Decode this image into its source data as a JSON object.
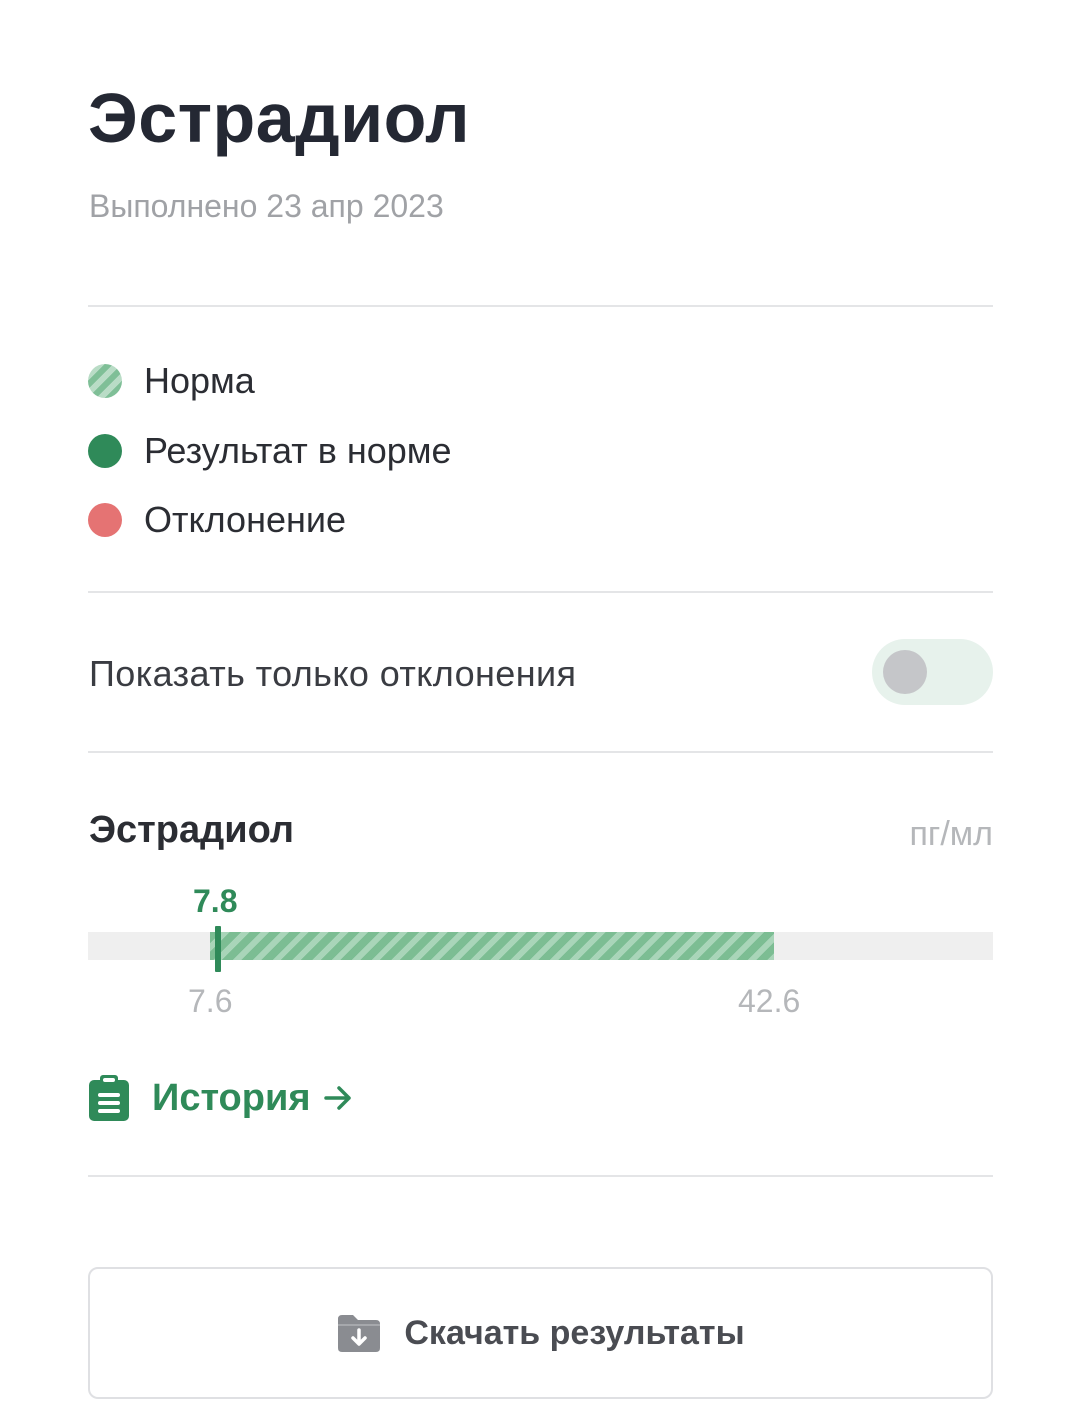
{
  "header": {
    "title": "Эстрадиол",
    "subtitle": "Выполнено 23 апр 2023"
  },
  "legend": {
    "items": [
      {
        "label": "Норма",
        "icon": "striped-green-dot-icon",
        "color": "#7fbf97"
      },
      {
        "label": "Результат в норме",
        "icon": "green-dot-icon",
        "color": "#2f8a59"
      },
      {
        "label": "Отклонение",
        "icon": "red-dot-icon",
        "color": "#e57373"
      }
    ]
  },
  "filter": {
    "label": "Показать только отклонения",
    "enabled": false
  },
  "result": {
    "name": "Эстрадиол",
    "unit": "пг/мл",
    "value": "7.8",
    "range_min": "7.6",
    "range_max": "42.6",
    "status_color": "#2f8a59"
  },
  "history": {
    "label": "История",
    "icon": "clipboard-icon"
  },
  "download": {
    "label": "Скачать результаты",
    "icon": "download-folder-icon"
  }
}
